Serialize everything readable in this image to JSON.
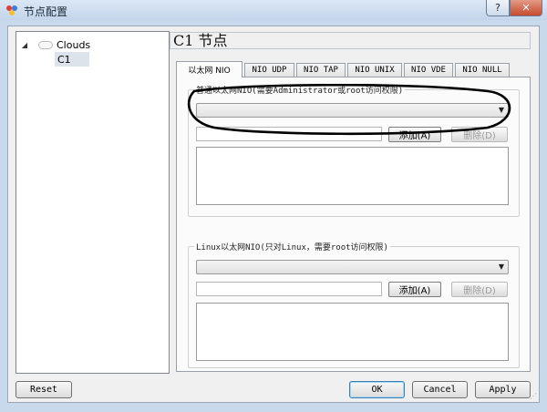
{
  "window": {
    "title": "节点配置",
    "help_label": "?",
    "close_label": "✕"
  },
  "tree": {
    "root": {
      "label": "Clouds",
      "expander": "◢",
      "icon": "cloud-icon"
    },
    "child": {
      "label": "C1"
    }
  },
  "node_title": "C1 节点",
  "tabs": [
    {
      "label": "以太网 NIO",
      "active": true
    },
    {
      "label": "NIO UDP"
    },
    {
      "label": "NIO TAP"
    },
    {
      "label": "NIO UNIX"
    },
    {
      "label": "NIO VDE"
    },
    {
      "label": "NIO NULL"
    }
  ],
  "generic_group": {
    "title": "普通以太网NIO(需要Administrator或root访问权限)",
    "combo_value": "",
    "input_value": "",
    "add_label": "添加(A)",
    "delete_label": "删除(D)"
  },
  "linux_group": {
    "title": "Linux以太网NIO(只对Linux，需要root访问权限)",
    "combo_value": "",
    "input_value": "",
    "add_label": "添加(A)",
    "delete_label": "删除(D)"
  },
  "footer": {
    "reset_label": "Reset",
    "ok_label": "OK",
    "cancel_label": "Cancel",
    "apply_label": "Apply"
  },
  "colors": {
    "window_frame": "#c9d9ec",
    "close_button": "#c54a2e",
    "annotation_ink": "#000000"
  }
}
